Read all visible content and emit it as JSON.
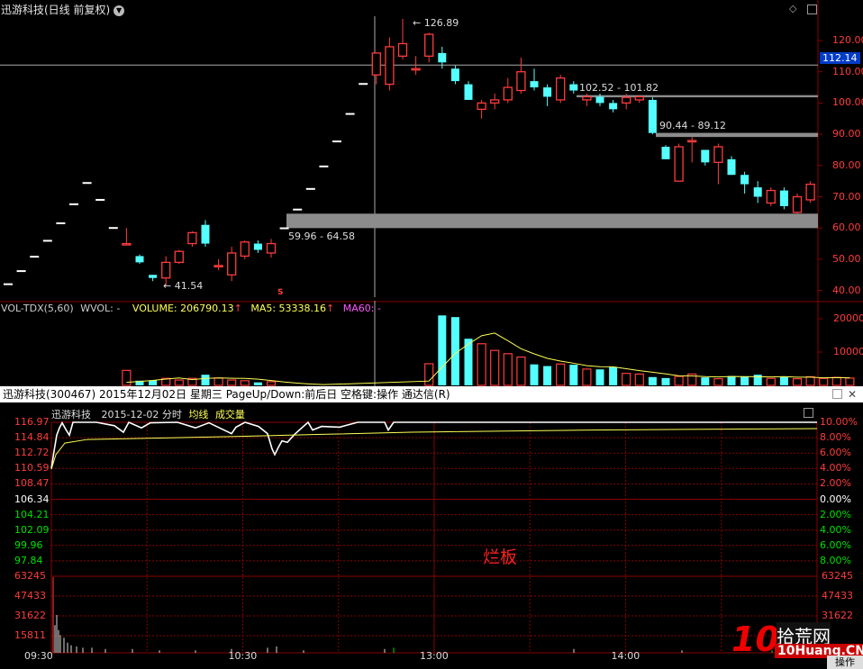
{
  "colors": {
    "up": "#ff3c3c",
    "down": "#54ffff",
    "grid": "#8b0000",
    "ma_vol": "#ffff55",
    "white": "#ffffff",
    "gray": "#8c8c8c",
    "vol_label": "#ffff55",
    "ma60_label": "#ff55ff",
    "crosshair": "#aaaaaa",
    "green_label": "#00e000"
  },
  "daily": {
    "title": "迅游科技(日线 前复权)",
    "chevron_icon": "chevron-down-icon",
    "y_ticks": [
      "120.00",
      "110.00",
      "100.00",
      "90.00",
      "80.00",
      "70.00",
      "60.00",
      "50.00",
      "40.00"
    ],
    "y_tick_values": [
      120,
      110,
      100,
      90,
      80,
      70,
      60,
      50,
      40
    ],
    "current_price": "112.14",
    "annotations": {
      "high": "126.89",
      "low": "41.54",
      "gap1": "102.52 - 101.82",
      "gap2": "90.44 - 89.12",
      "gap3": "59.96 - 64.58",
      "marker": "S"
    },
    "candles": [
      {
        "o": 42,
        "h": 42,
        "l": 42,
        "c": 42
      },
      {
        "o": 46.2,
        "h": 46.2,
        "l": 46.2,
        "c": 46.2
      },
      {
        "o": 50.8,
        "h": 50.8,
        "l": 50.8,
        "c": 50.8
      },
      {
        "o": 55.9,
        "h": 55.9,
        "l": 55.9,
        "c": 55.9
      },
      {
        "o": 61.5,
        "h": 61.5,
        "l": 61.5,
        "c": 61.5
      },
      {
        "o": 67.6,
        "h": 67.6,
        "l": 67.6,
        "c": 67.6
      },
      {
        "o": 74.4,
        "h": 74.4,
        "l": 74.4,
        "c": 74.4
      },
      {
        "o": 69,
        "h": 69,
        "l": 69,
        "c": 69
      },
      {
        "o": 60,
        "h": 60,
        "l": 60,
        "c": 60
      },
      {
        "o": 55,
        "h": 60,
        "l": 55,
        "c": 55
      },
      {
        "o": 51,
        "h": 51.5,
        "l": 48.5,
        "c": 49
      },
      {
        "o": 45,
        "h": 45,
        "l": 43,
        "c": 44
      },
      {
        "o": 44,
        "h": 51,
        "l": 41.5,
        "c": 49
      },
      {
        "o": 49,
        "h": 53,
        "l": 48.5,
        "c": 52.5
      },
      {
        "o": 55,
        "h": 59,
        "l": 54,
        "c": 58.5
      },
      {
        "o": 61,
        "h": 62.5,
        "l": 54,
        "c": 55
      },
      {
        "o": 48,
        "h": 50,
        "l": 46.5,
        "c": 48
      },
      {
        "o": 45,
        "h": 54,
        "l": 43,
        "c": 52
      },
      {
        "o": 51,
        "h": 56,
        "l": 50,
        "c": 55.5
      },
      {
        "o": 55,
        "h": 56,
        "l": 52,
        "c": 53
      },
      {
        "o": 52,
        "h": 56.5,
        "l": 50.5,
        "c": 55
      },
      {
        "o": 59.9,
        "h": 59.9,
        "l": 59.9,
        "c": 59.9
      },
      {
        "o": 65.9,
        "h": 65.9,
        "l": 65.9,
        "c": 65.9
      },
      {
        "o": 72.5,
        "h": 72.5,
        "l": 72.5,
        "c": 72.5
      },
      {
        "o": 79.7,
        "h": 79.7,
        "l": 79.7,
        "c": 79.7
      },
      {
        "o": 87.7,
        "h": 87.7,
        "l": 87.7,
        "c": 87.7
      },
      {
        "o": 96.5,
        "h": 96.5,
        "l": 96.5,
        "c": 96.5
      },
      {
        "o": 106.1,
        "h": 106.1,
        "l": 106.1,
        "c": 106.1
      },
      {
        "o": 109,
        "h": 116,
        "l": 106,
        "c": 116
      },
      {
        "o": 106,
        "h": 121,
        "l": 104,
        "c": 118
      },
      {
        "o": 115,
        "h": 126.9,
        "l": 114,
        "c": 119
      },
      {
        "o": 111,
        "h": 115,
        "l": 109,
        "c": 111
      },
      {
        "o": 115,
        "h": 122.5,
        "l": 113,
        "c": 122
      },
      {
        "o": 116,
        "h": 118,
        "l": 111,
        "c": 113
      },
      {
        "o": 111,
        "h": 112,
        "l": 106,
        "c": 107
      },
      {
        "o": 106,
        "h": 107,
        "l": 101,
        "c": 101
      },
      {
        "o": 98,
        "h": 101,
        "l": 95,
        "c": 100
      },
      {
        "o": 100,
        "h": 103,
        "l": 98,
        "c": 101
      },
      {
        "o": 101,
        "h": 108,
        "l": 100,
        "c": 105
      },
      {
        "o": 104,
        "h": 114.5,
        "l": 103,
        "c": 110
      },
      {
        "o": 107,
        "h": 111,
        "l": 104,
        "c": 105
      },
      {
        "o": 105,
        "h": 106,
        "l": 99,
        "c": 102
      },
      {
        "o": 101,
        "h": 109,
        "l": 100,
        "c": 108
      },
      {
        "o": 106,
        "h": 107,
        "l": 103,
        "c": 104
      },
      {
        "o": 101,
        "h": 103,
        "l": 99,
        "c": 102
      },
      {
        "o": 102,
        "h": 103,
        "l": 99,
        "c": 100
      },
      {
        "o": 100,
        "h": 101,
        "l": 97,
        "c": 98
      },
      {
        "o": 100,
        "h": 103,
        "l": 98,
        "c": 101.8
      },
      {
        "o": 101,
        "h": 102.5,
        "l": 100,
        "c": 102
      },
      {
        "o": 101,
        "h": 101.8,
        "l": 90,
        "c": 90.4
      },
      {
        "o": 86,
        "h": 86.5,
        "l": 82,
        "c": 82
      },
      {
        "o": 75,
        "h": 87,
        "l": 75,
        "c": 86
      },
      {
        "o": 88,
        "h": 89.1,
        "l": 81,
        "c": 88
      },
      {
        "o": 85,
        "h": 85,
        "l": 80,
        "c": 81
      },
      {
        "o": 81,
        "h": 87,
        "l": 74,
        "c": 86
      },
      {
        "o": 82,
        "h": 83,
        "l": 77,
        "c": 77
      },
      {
        "o": 77,
        "h": 78,
        "l": 71,
        "c": 74
      },
      {
        "o": 73,
        "h": 75,
        "l": 68,
        "c": 70
      },
      {
        "o": 68,
        "h": 73,
        "l": 67,
        "c": 72
      },
      {
        "o": 72,
        "h": 73,
        "l": 66,
        "c": 67
      },
      {
        "o": 65,
        "h": 71,
        "l": 64.6,
        "c": 70
      },
      {
        "o": 69,
        "h": 75,
        "l": 68,
        "c": 74
      }
    ]
  },
  "volume": {
    "title": "VOL-TDX(5,60)",
    "wvol": "WVOL: -",
    "volume": "VOLUME: 206790.13",
    "ma5": "MA5: 53338.16",
    "ma60": "MA60: -",
    "y_ticks": [
      "20000",
      "10000"
    ],
    "y_tick_values": [
      20000,
      10000
    ],
    "bars": [
      0,
      0,
      0,
      0,
      0,
      0,
      0,
      0,
      0,
      4500,
      1400,
      1500,
      2100,
      1600,
      2100,
      3200,
      2200,
      1600,
      1400,
      900,
      1100,
      0,
      0,
      0,
      0,
      0,
      0,
      0,
      0,
      0,
      0,
      0,
      6500,
      21000,
      20500,
      14000,
      12500,
      10500,
      9500,
      8500,
      6300,
      5800,
      6400,
      6200,
      4900,
      4800,
      5500,
      3600,
      3400,
      2500,
      2200,
      2700,
      3400,
      2400,
      2000,
      2800,
      2600,
      3200,
      2100,
      2500,
      2000,
      2600,
      2100,
      2400,
      2200
    ]
  },
  "minute_window": {
    "title": "迅游科技(300467) 2015年12月02日 星期三 PageUp/Down:前后日 空格键:操作 通达信(R)",
    "legend_name": "迅游科技",
    "legend_date": "2015-12-02 分时",
    "legend_avg": "均线",
    "legend_vol": "成交量",
    "left_prices": [
      "116.97",
      "114.84",
      "112.72",
      "110.59",
      "108.47",
      "106.34",
      "104.21",
      "102.09",
      "99.96",
      "97.84"
    ],
    "right_pcts": [
      "10.00%",
      "8.00%",
      "6.00%",
      "4.00%",
      "2.00%",
      "0.00%",
      "2.00%",
      "4.00%",
      "6.00%",
      "8.00%"
    ],
    "vol_left": [
      "63245",
      "47433",
      "31622",
      "15811"
    ],
    "vol_right": [
      "63245",
      "47433",
      "31622"
    ],
    "time_labels": [
      "09:30",
      "10:30",
      "13:00",
      "14:00"
    ],
    "annotation": "烂板",
    "operate": "操作",
    "ctrl_icons": [
      "restore-icon",
      "close-icon"
    ]
  },
  "watermark": {
    "num": "10",
    "text": "拾荒网",
    "url": "10Huang.CN"
  }
}
